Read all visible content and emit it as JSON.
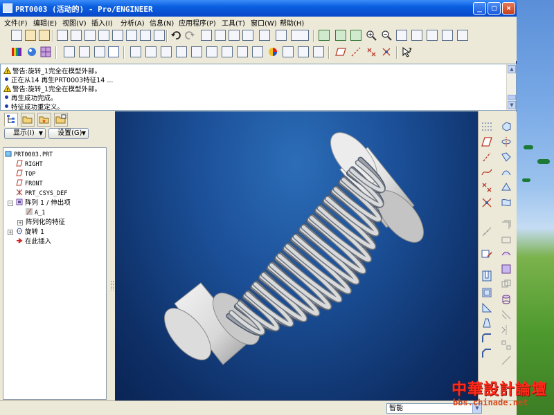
{
  "window": {
    "title": "PRT0003 (活动的) - Pro/ENGINEER",
    "minimize": "_",
    "maximize": "□",
    "close": "×"
  },
  "menu": [
    "文件(F)",
    "编辑(E)",
    "视图(V)",
    "插入(I)",
    "分析(A)",
    "信息(N)",
    "应用程序(P)",
    "工具(T)",
    "窗口(W)",
    "帮助(H)"
  ],
  "messages": [
    {
      "type": "warning",
      "text": "警告:旋转_1完全在模型外部。"
    },
    {
      "type": "info",
      "text": "正在从14 再生PRT0003特征14 ..."
    },
    {
      "type": "warning",
      "text": "警告:旋转_1完全在模型外部。"
    },
    {
      "type": "info",
      "text": "再生成功完成。"
    },
    {
      "type": "info",
      "text": "特征成功重定义。"
    }
  ],
  "panel": {
    "show_button": "显示",
    "show_hotkey": "(I)",
    "settings_button": "设置",
    "settings_hotkey": "(G)"
  },
  "tree": [
    {
      "label": "PRT0003.PRT",
      "icon": "part-icon"
    },
    {
      "label": "RIGHT",
      "icon": "datum-plane-icon"
    },
    {
      "label": "TOP",
      "icon": "datum-plane-icon"
    },
    {
      "label": "FRONT",
      "icon": "datum-plane-icon"
    },
    {
      "label": "PRT_CSYS_DEF",
      "icon": "csys-icon"
    },
    {
      "label": "阵列 1 / 伸出项",
      "icon": "pattern-icon"
    },
    {
      "label": "A_1",
      "icon": "axis-icon"
    },
    {
      "label": "阵列化的特征",
      "icon": "none"
    },
    {
      "label": "旋转 1",
      "icon": "revolve-icon"
    },
    {
      "label": "在此插入",
      "icon": "insert-here-icon"
    }
  ],
  "status": {
    "filter": "智能"
  },
  "watermark": {
    "title": "中華設計論壇",
    "url": "bbs.chinade.net"
  },
  "colors": {
    "titlebar": "#0a5fe0",
    "viewport_top": "#2c6db8",
    "viewport_bottom": "#0a2455",
    "model": "#d9dadc",
    "watermark": "#ff2a1a"
  }
}
